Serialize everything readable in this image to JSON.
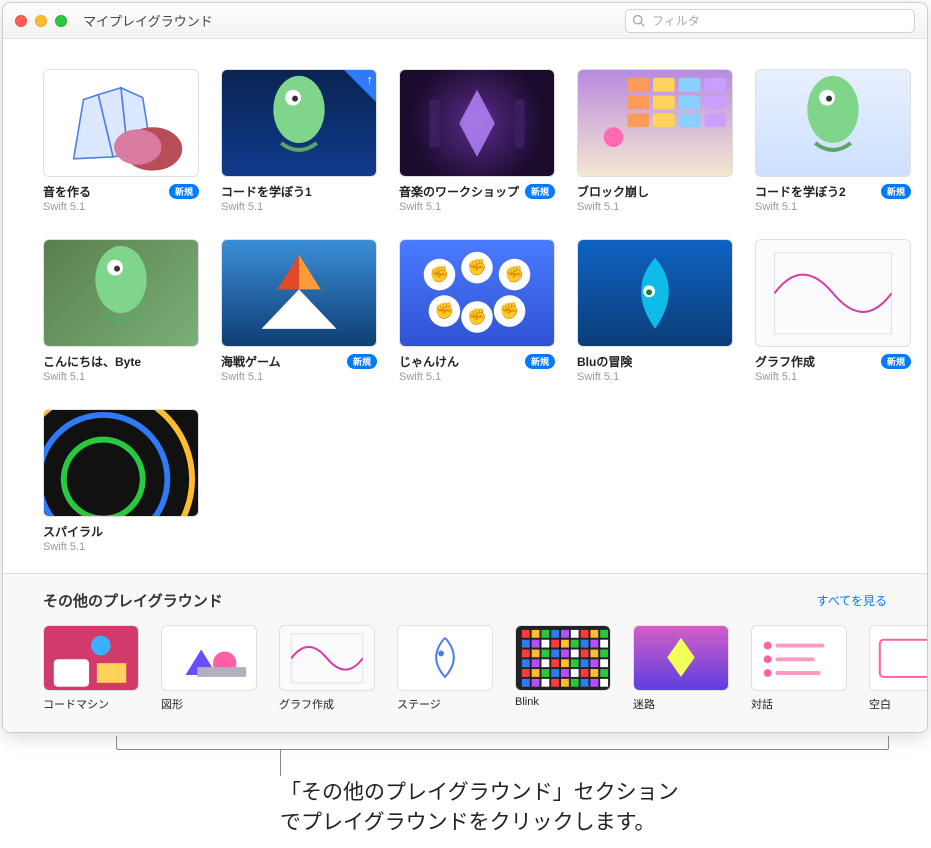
{
  "window": {
    "title": "マイプレイグラウンド"
  },
  "search": {
    "placeholder": "フィルタ"
  },
  "badge_text": "新規",
  "cards": [
    {
      "title": "音を作る",
      "subtitle": "Swift 5.1",
      "badge": true,
      "corner": false,
      "art": "art-crystal"
    },
    {
      "title": "コードを学ぼう1",
      "subtitle": "Swift 5.1",
      "badge": false,
      "corner": true,
      "art": "art-ltc1"
    },
    {
      "title": "音楽のワークショップ",
      "subtitle": "Swift 5.1",
      "badge": true,
      "corner": false,
      "art": "art-music"
    },
    {
      "title": "ブロック崩し",
      "subtitle": "Swift 5.1",
      "badge": false,
      "corner": false,
      "art": "art-brick"
    },
    {
      "title": "コードを学ぼう2",
      "subtitle": "Swift 5.1",
      "badge": true,
      "corner": false,
      "art": "art-ltc2"
    },
    {
      "title": "こんにちは、Byte",
      "subtitle": "Swift 5.1",
      "badge": false,
      "corner": false,
      "art": "art-byte"
    },
    {
      "title": "海戦ゲーム",
      "subtitle": "Swift 5.1",
      "badge": true,
      "corner": false,
      "art": "art-sea"
    },
    {
      "title": "じゃんけん",
      "subtitle": "Swift 5.1",
      "badge": true,
      "corner": false,
      "art": "art-rps"
    },
    {
      "title": "Bluの冒険",
      "subtitle": "Swift 5.1",
      "badge": false,
      "corner": false,
      "art": "art-blu"
    },
    {
      "title": "グラフ作成",
      "subtitle": "Swift 5.1",
      "badge": true,
      "corner": false,
      "art": "art-graph"
    },
    {
      "title": "スパイラル",
      "subtitle": "Swift 5.1",
      "badge": false,
      "corner": false,
      "art": "art-spiral"
    }
  ],
  "section": {
    "title": "その他のプレイグラウンド",
    "see_all": "すべてを見る",
    "items": [
      {
        "title": "コードマシン",
        "art": "art-cm"
      },
      {
        "title": "図形",
        "art": "art-shapes"
      },
      {
        "title": "グラフ作成",
        "art": "art-graph"
      },
      {
        "title": "ステージ",
        "art": "art-stage"
      },
      {
        "title": "Blink",
        "art": "art-blink"
      },
      {
        "title": "迷路",
        "art": "art-maze"
      },
      {
        "title": "対話",
        "art": "art-answers"
      },
      {
        "title": "空白",
        "art": "art-blank"
      }
    ]
  },
  "callout": {
    "line1": "「その他のプレイグラウンド」セクション",
    "line2": "でプレイグラウンドをクリックします。"
  }
}
